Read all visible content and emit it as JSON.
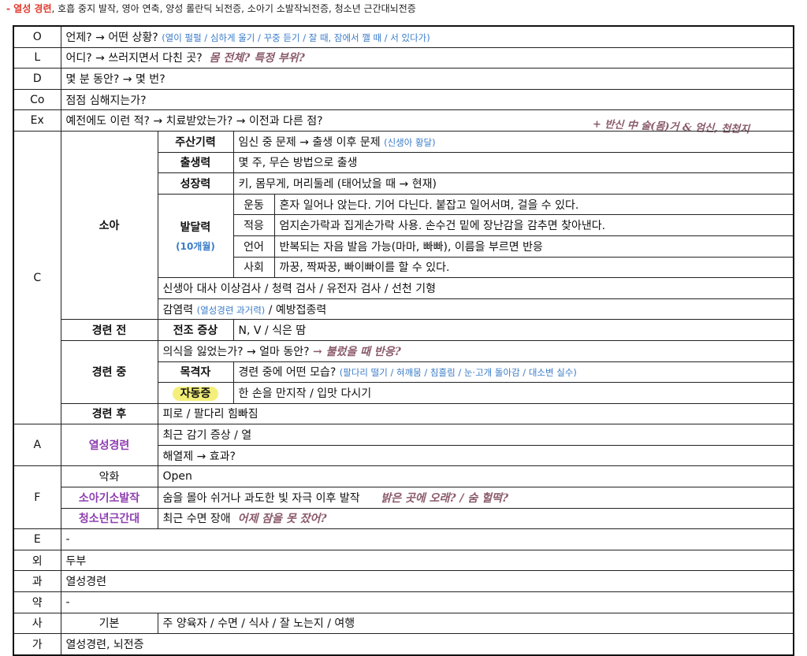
{
  "header": {
    "red": "- 열성 경련",
    "rest": ", 호흡 중지 발작, 영아 연축, 양성 롤란딕 뇌전증, 소아기 소발작뇌전증, 청소년 근간대뇌전증"
  },
  "rows": {
    "O": {
      "key": "O",
      "text": "언제? → 어떤 상황?",
      "sub": "(열이 펄펄 / 심하게 울기 / 꾸중 듣기 / 잘 때, 잠에서 깰 때 / 서 있다가)"
    },
    "L": {
      "key": "L",
      "text": "어디? → 쓰러지면서 다친 곳?",
      "hand": "몸 전체? 특정 부위?"
    },
    "D": {
      "key": "D",
      "text": "몇 분 동안? → 몇 번?"
    },
    "Co": {
      "key": "Co",
      "text": "점점 심해지는가?"
    },
    "Ex": {
      "key": "Ex",
      "text": "예전에도 이런 적? → 치료받았는가? → 이전과 다른 점?"
    },
    "note": "+ 반신 中 술(몸)거 & 엄신, 천천지",
    "C": {
      "key": "C",
      "child": "소아",
      "prenatal": {
        "label": "주산기력",
        "text": "임신 중 문제 → 출생 이후 문제",
        "sub": "(신생아 황달)"
      },
      "birth": {
        "label": "출생력",
        "text": "몇 주, 무슨 방법으로 출생"
      },
      "growth": {
        "label": "성장력",
        "text": "키, 몸무게, 머리둘레 (태어났을 때 → 현재)"
      },
      "dev": {
        "label": "발달력",
        "age": "(10개월)",
        "items": [
          {
            "k": "운동",
            "v": "혼자 일어나 앉는다. 기어 다닌다. 붙잡고 일어서며, 걸을 수 있다."
          },
          {
            "k": "적응",
            "v": "엄지손가락과 집게손가락 사용. 손수건 밑에 장난감을 감추면 찾아낸다."
          },
          {
            "k": "언어",
            "v": "반복되는 자음 발음 가능(마마, 빠빠), 이름을 부르면 반응"
          },
          {
            "k": "사회",
            "v": "까꿍, 짝짜꿍, 빠이빠이를 할 수 있다."
          }
        ]
      },
      "newborn": "신생아 대사 이상검사 / 청력 검사 / 유전자 검사 / 선천 기형",
      "infection": {
        "text": "감염력",
        "sub": "(열성경련 과거력)",
        "rest": "/ 예방접종력"
      },
      "before": {
        "label": "경련 전",
        "sub_label": "전조 증상",
        "text": "N, V / 식은 땀"
      },
      "during": {
        "label": "경련 중",
        "q": "의식을 잃었는가? → 얼마 동안?",
        "q_hand": "→ 불렀을 때 반응?",
        "witness": {
          "label": "목격자",
          "text": "경련 중에 어떤 모습?",
          "sub": "(팔다리 떨기 / 혀깨뭄 / 침흘림 / 눈·고개 돌아감 / 대소변 실수)"
        },
        "auto": {
          "label": "자동증",
          "text": "한 손을 만지작 / 입맛 다시기"
        }
      },
      "after": {
        "label": "경련 후",
        "text": "피로 / 팔다리 힘빠짐"
      }
    },
    "A": {
      "key": "A",
      "label": "열성경련",
      "lines": [
        "최근 감기 증상 / 열",
        "해열제 → 효과?"
      ]
    },
    "F": {
      "key": "F",
      "r1": {
        "label": "악화",
        "text": "Open"
      },
      "r2": {
        "label": "소아기소발작",
        "text": "숨을 몰아 쉬거나 과도한 빛 자극 이후 발작",
        "hand": "밝은 곳에 오래? / 숨 헐떡?"
      },
      "r3": {
        "label": "청소년근간대",
        "text": "최근 수면 장애",
        "hand": "어제 잠을 못 잤어?"
      }
    },
    "E": {
      "key": "E",
      "text": "-"
    },
    "oe": {
      "key": "외",
      "text": "두부"
    },
    "gwa": {
      "key": "과",
      "text": "열성경련"
    },
    "yak": {
      "key": "약",
      "text": "-"
    },
    "sa": {
      "key": "사",
      "label": "기본",
      "text": "주 양육자 / 수면 / 식사 / 잘 노는지 / 여행"
    },
    "ga": {
      "key": "가",
      "text": "열성경련, 뇌전증"
    }
  }
}
